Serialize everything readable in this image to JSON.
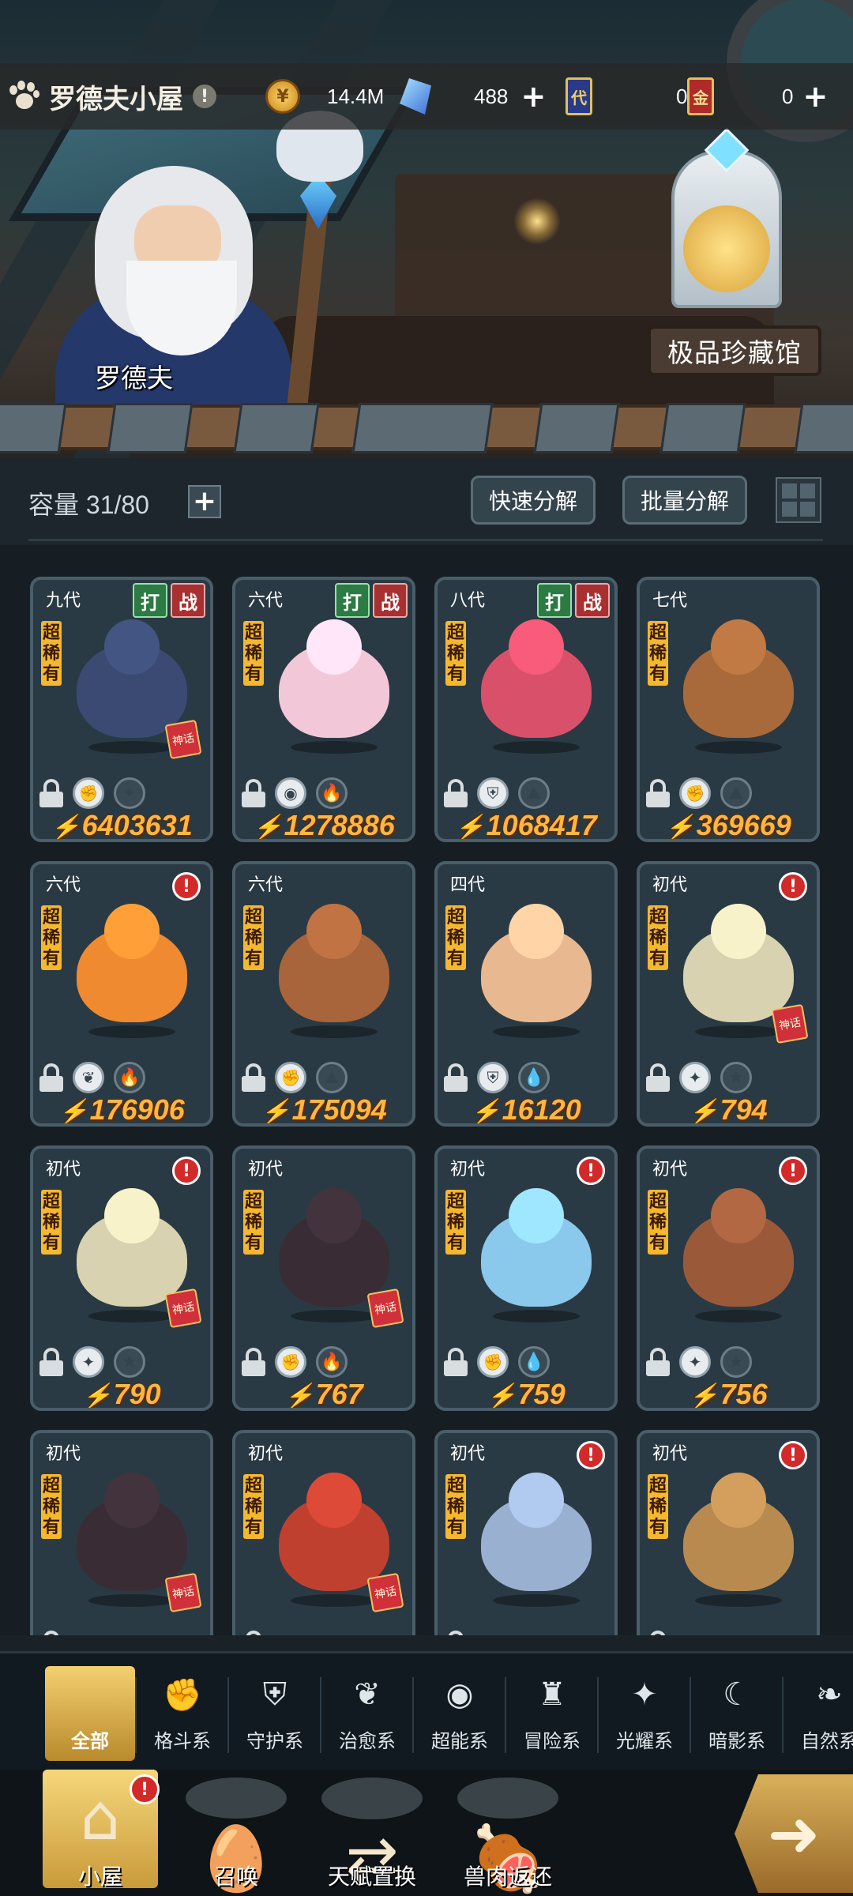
{
  "header": {
    "title": "罗德夫小屋",
    "info_badge": "!",
    "resources": {
      "gold": "14.4M",
      "crystal": "488",
      "card_blue": "0",
      "card_blue_icon": "代",
      "card_red": "0",
      "card_red_icon": "金"
    }
  },
  "scene": {
    "npc_name": "罗德夫",
    "collection_label": "极品珍藏馆"
  },
  "toolbar": {
    "capacity_label": "容量 31/80",
    "quick_decompose": "快速分解",
    "batch_decompose": "批量分解"
  },
  "pets": [
    {
      "gen": "九代",
      "rarity": "超稀有",
      "power": "6403631",
      "tags": [
        "打",
        "战"
      ],
      "alert": false,
      "mythic": "神话",
      "elements": [
        "格斗",
        "光耀"
      ],
      "color": "#3a4a72"
    },
    {
      "gen": "六代",
      "rarity": "超稀有",
      "power": "1278886",
      "tags": [
        "打",
        "战"
      ],
      "alert": false,
      "mythic": "",
      "elements": [
        "超能",
        "火"
      ],
      "color": "#f2c8d8"
    },
    {
      "gen": "八代",
      "rarity": "超稀有",
      "power": "1068417",
      "tags": [
        "打",
        "战"
      ],
      "alert": false,
      "mythic": "",
      "elements": [
        "守护",
        "土"
      ],
      "color": "#d8506a"
    },
    {
      "gen": "七代",
      "rarity": "超稀有",
      "power": "369669",
      "tags": [],
      "alert": false,
      "mythic": "",
      "elements": [
        "格斗",
        "土"
      ],
      "color": "#a86a3a"
    },
    {
      "gen": "六代",
      "rarity": "超稀有",
      "power": "176906",
      "tags": [],
      "alert": true,
      "mythic": "",
      "elements": [
        "治愈",
        "火"
      ],
      "color": "#f08a30"
    },
    {
      "gen": "六代",
      "rarity": "超稀有",
      "power": "175094",
      "tags": [],
      "alert": false,
      "mythic": "",
      "elements": [
        "格斗",
        "土"
      ],
      "color": "#a8643a"
    },
    {
      "gen": "四代",
      "rarity": "超稀有",
      "power": "16120",
      "tags": [],
      "alert": false,
      "mythic": "",
      "elements": [
        "守护",
        "水"
      ],
      "color": "#e8b890"
    },
    {
      "gen": "初代",
      "rarity": "超稀有",
      "power": "794",
      "tags": [],
      "alert": true,
      "mythic": "神话",
      "elements": [
        "光耀",
        "光"
      ],
      "color": "#d8d2b0"
    },
    {
      "gen": "初代",
      "rarity": "超稀有",
      "power": "790",
      "tags": [],
      "alert": true,
      "mythic": "神话",
      "elements": [
        "光耀",
        "光"
      ],
      "color": "#d8d2b0"
    },
    {
      "gen": "初代",
      "rarity": "超稀有",
      "power": "767",
      "tags": [],
      "alert": false,
      "mythic": "神话",
      "elements": [
        "格斗",
        "火"
      ],
      "color": "#3a2c34"
    },
    {
      "gen": "初代",
      "rarity": "超稀有",
      "power": "759",
      "tags": [],
      "alert": true,
      "mythic": "",
      "elements": [
        "格斗",
        "水"
      ],
      "color": "#8ac8ec"
    },
    {
      "gen": "初代",
      "rarity": "超稀有",
      "power": "756",
      "tags": [],
      "alert": true,
      "mythic": "",
      "elements": [
        "光耀",
        "光"
      ],
      "color": "#9a5a3a"
    },
    {
      "gen": "初代",
      "rarity": "超稀有",
      "power": "",
      "tags": [],
      "alert": false,
      "mythic": "神话",
      "elements": [],
      "color": "#3a2c34"
    },
    {
      "gen": "初代",
      "rarity": "超稀有",
      "power": "",
      "tags": [],
      "alert": false,
      "mythic": "神话",
      "elements": [],
      "color": "#c04030"
    },
    {
      "gen": "初代",
      "rarity": "超稀有",
      "power": "",
      "tags": [],
      "alert": true,
      "mythic": "",
      "elements": [],
      "color": "#9ab0d0"
    },
    {
      "gen": "初代",
      "rarity": "超稀有",
      "power": "",
      "tags": [],
      "alert": true,
      "mythic": "",
      "elements": [],
      "color": "#b88a50"
    }
  ],
  "filters": [
    {
      "label": "全部",
      "icon": "all-icon",
      "active": true
    },
    {
      "label": "格斗系",
      "icon": "fist-icon"
    },
    {
      "label": "守护系",
      "icon": "shield-icon"
    },
    {
      "label": "治愈系",
      "icon": "sprout-icon"
    },
    {
      "label": "超能系",
      "icon": "psychic-icon"
    },
    {
      "label": "冒险系",
      "icon": "adventure-icon"
    },
    {
      "label": "光耀系",
      "icon": "sparkle-icon"
    },
    {
      "label": "暗影系",
      "icon": "shadow-icon"
    },
    {
      "label": "自然系",
      "icon": "leaf-icon"
    }
  ],
  "bottom_nav": [
    {
      "label": "小屋",
      "icon": "house-icon",
      "active": true,
      "alert": "!"
    },
    {
      "label": "召唤",
      "icon": "egg-icon"
    },
    {
      "label": "天赋置换",
      "icon": "swap-icon"
    },
    {
      "label": "兽肉返还",
      "icon": "meat-icon"
    }
  ]
}
